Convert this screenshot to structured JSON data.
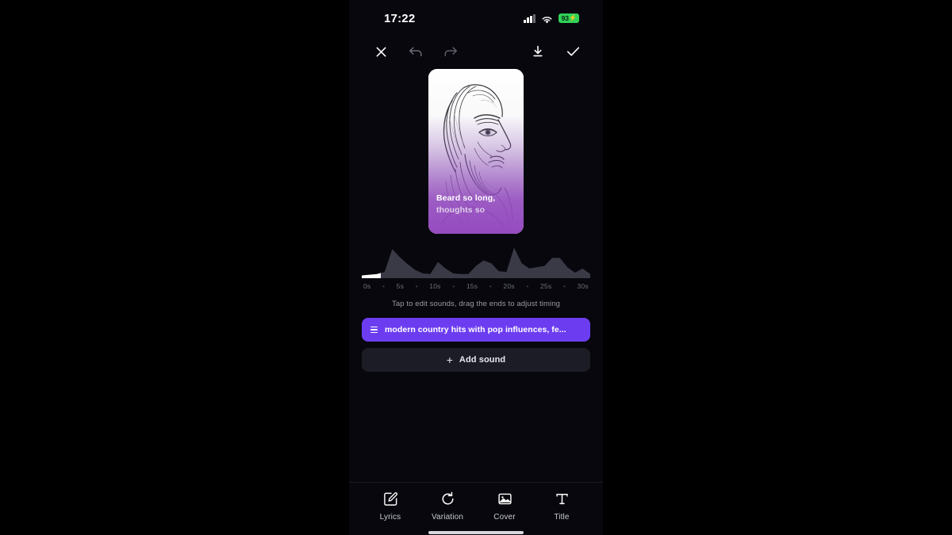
{
  "status_bar": {
    "time": "17:22",
    "signal_icon": "cellular-signal-icon",
    "wifi_icon": "wifi-icon",
    "battery_level": "93",
    "battery_bolt": "⚡",
    "battery_color": "#31d158"
  },
  "toolbar": {
    "close_label": "×",
    "undo_label": "undo",
    "redo_label": "redo",
    "download_label": "download",
    "confirm_label": "done"
  },
  "cover": {
    "lyric_line_1": "Beard so long,",
    "lyric_line_2": "thoughts so",
    "overlay_color": "#9346bf",
    "art_description": "pencil-sketch-bearded-man-profile"
  },
  "timeline": {
    "ticks": [
      "0s",
      "5s",
      "10s",
      "15s",
      "20s",
      "25s",
      "30s"
    ],
    "tick_separator": "•",
    "hint": "Tap to edit sounds, drag the ends to adjust timing",
    "selection_color": "#ffffff",
    "wave_color": "#3a3a47"
  },
  "sounds": {
    "items": [
      {
        "label": "modern country hits with pop influences, fe...",
        "icon": "list-handle-icon",
        "color": "#6c3df0"
      }
    ],
    "add_button": {
      "label": "Add sound",
      "plus": "+"
    }
  },
  "bottom_nav": {
    "items": [
      {
        "label": "Lyrics",
        "icon": "edit-square-pencil-icon"
      },
      {
        "label": "Variation",
        "icon": "refresh-rotate-icon"
      },
      {
        "label": "Cover",
        "icon": "image-photo-icon"
      },
      {
        "label": "Title",
        "icon": "text-title-icon"
      }
    ]
  },
  "chart_data": {
    "type": "area",
    "title": "",
    "xlabel": "",
    "ylabel": "",
    "x": [
      0,
      1,
      2,
      3,
      4,
      5,
      6,
      7,
      8,
      9,
      10,
      11,
      12,
      13,
      14,
      15,
      16,
      17,
      18,
      19,
      20,
      21,
      22,
      23,
      24,
      25,
      26,
      27,
      28,
      29,
      30
    ],
    "values": [
      4,
      5,
      6,
      9,
      42,
      30,
      20,
      12,
      7,
      6,
      24,
      14,
      7,
      6,
      6,
      18,
      26,
      22,
      10,
      9,
      44,
      22,
      14,
      16,
      18,
      30,
      30,
      16,
      8,
      14,
      6
    ],
    "xlim": [
      0,
      30
    ],
    "ylim": [
      0,
      48
    ],
    "grid": false,
    "legend": false,
    "selection_range": [
      0.4,
      2.5
    ],
    "tick_labels": [
      "0s",
      "5s",
      "10s",
      "15s",
      "20s",
      "25s",
      "30s"
    ]
  }
}
